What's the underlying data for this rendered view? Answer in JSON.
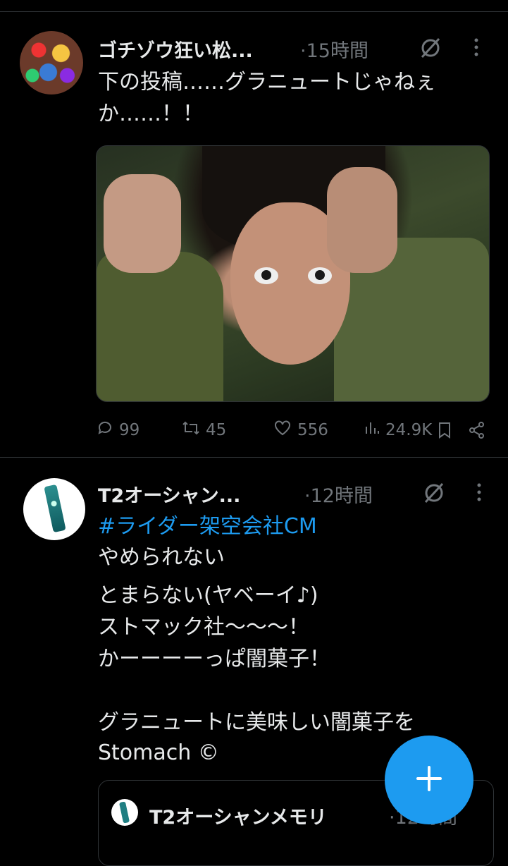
{
  "posts": [
    {
      "author": "ゴチゾウ狂い松...",
      "time": "·15時間",
      "text_lines": [
        "下の投稿……グラニュートじゃねぇ",
        "か……！！"
      ],
      "stats": {
        "replies": "99",
        "reposts": "45",
        "likes": "556",
        "views": "24.9K"
      }
    },
    {
      "author": "T2オーシャン...",
      "time": "·12時間",
      "hashtag": "#ライダー架空会社CM",
      "text_lines": [
        "やめられない",
        "とまらない(ヤベーイ♪)",
        "ストマック社〜〜〜！",
        "かーーーーっぱ闇菓子！",
        "",
        "グラニュートに美味しい闇菓子を",
        "Stomach ©"
      ],
      "quote": {
        "author": "T2オーシャンメモリ",
        "time": "·12時間"
      }
    }
  ],
  "icons": [
    "grok-icon",
    "more-icon",
    "reply-icon",
    "repost-icon",
    "like-icon",
    "views-icon",
    "bookmark-icon",
    "share-icon",
    "compose-icon"
  ],
  "colors": {
    "accent": "#1d9bf0",
    "muted": "#71767b",
    "text": "#e7e9ea",
    "border": "#2f3336"
  }
}
